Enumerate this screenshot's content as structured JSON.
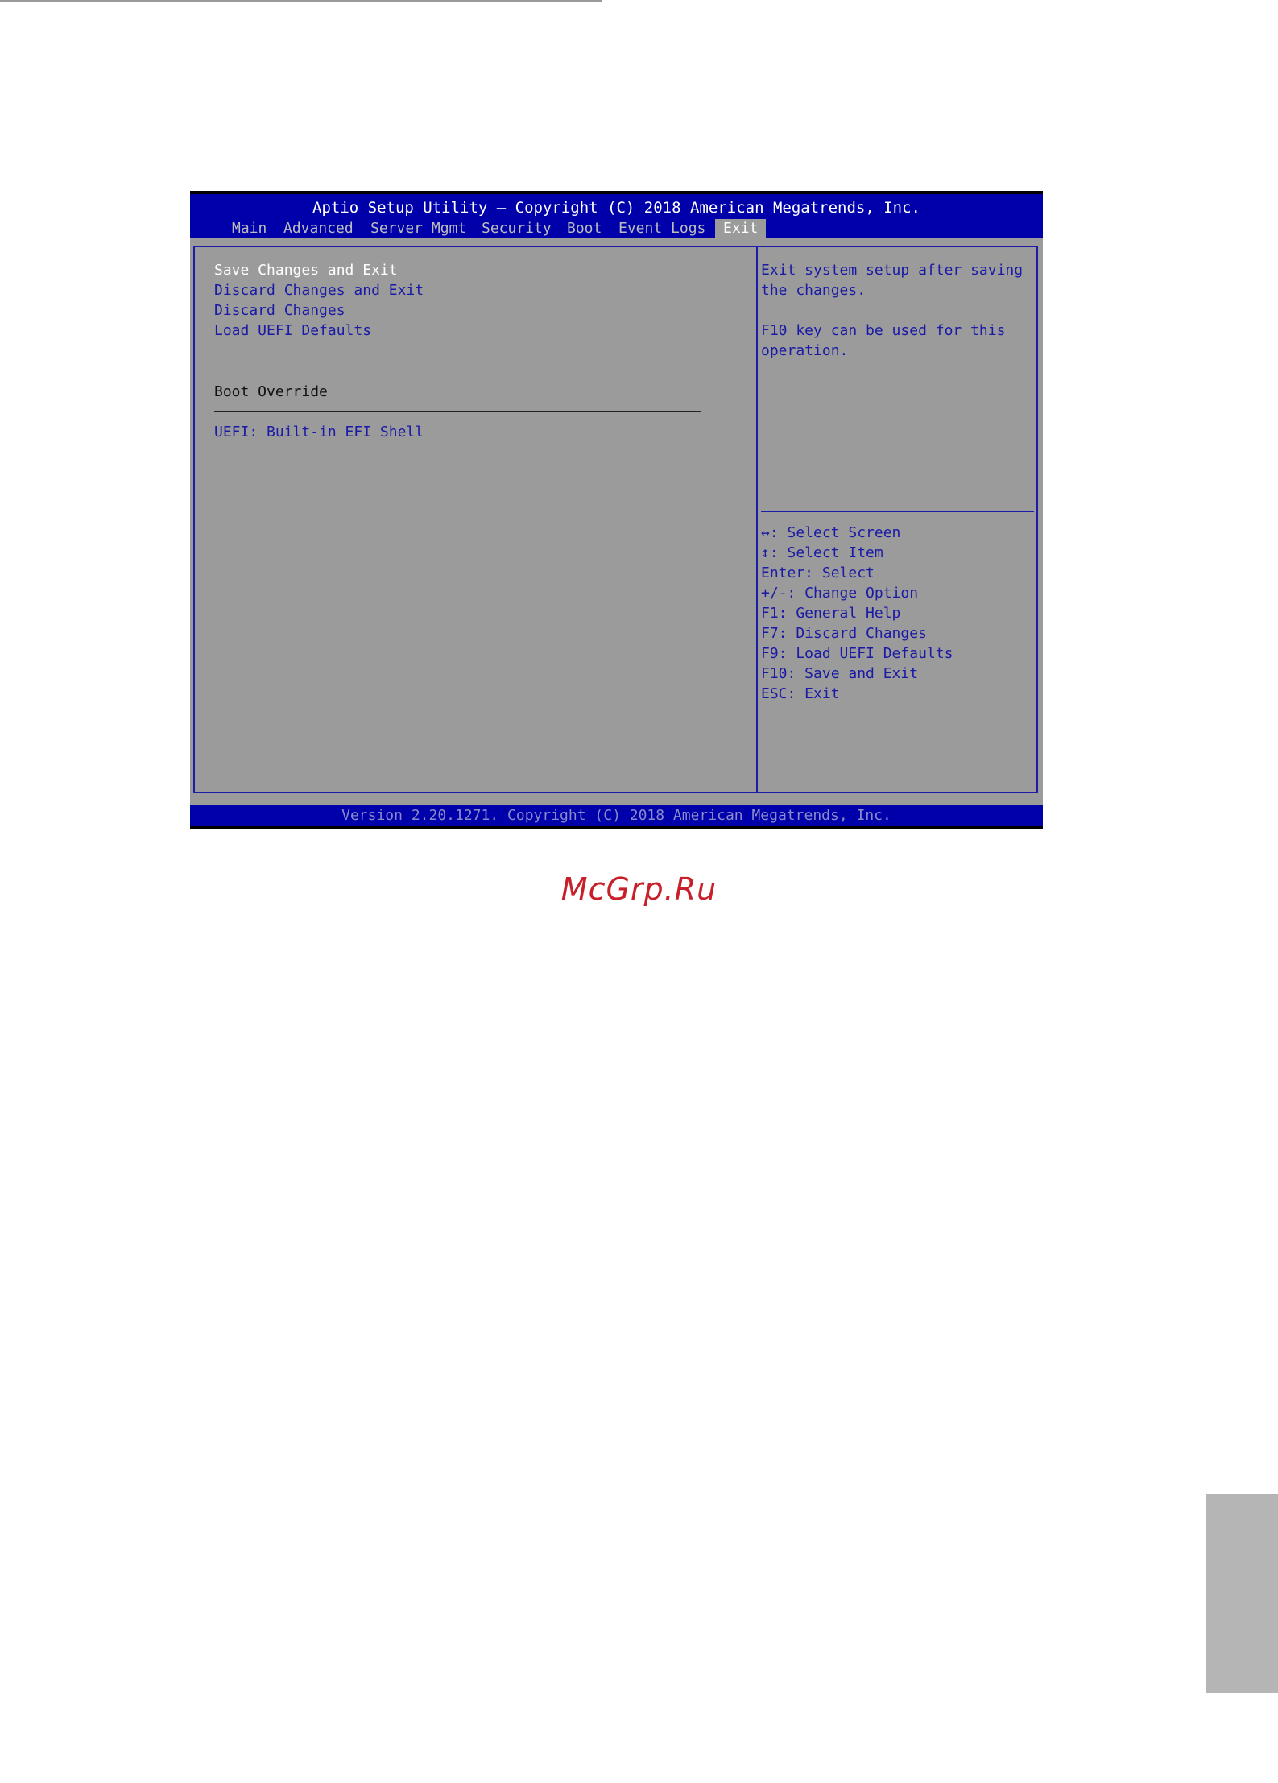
{
  "header": {
    "title": "Aptio Setup Utility – Copyright (C) 2018 American Megatrends, Inc."
  },
  "tabs": [
    {
      "label": "Main"
    },
    {
      "label": "Advanced"
    },
    {
      "label": "Server Mgmt"
    },
    {
      "label": "Security"
    },
    {
      "label": "Boot"
    },
    {
      "label": "Event Logs"
    },
    {
      "label": "Exit"
    }
  ],
  "active_tab": "Exit",
  "menu": {
    "items": [
      {
        "label": "Save Changes and Exit"
      },
      {
        "label": "Discard Changes and Exit"
      },
      {
        "label": "Discard Changes"
      },
      {
        "label": "Load UEFI Defaults"
      }
    ],
    "section_title": "Boot Override",
    "boot_items": [
      {
        "label": "UEFI: Built-in EFI Shell"
      }
    ]
  },
  "help": {
    "lines": [
      "Exit system setup after saving",
      "the changes.",
      "",
      "F10 key can be used for this",
      "operation."
    ],
    "keys": [
      "↔: Select Screen",
      "↕: Select Item",
      "Enter: Select",
      "+/-: Change Option",
      "F1: General Help",
      "F7: Discard Changes",
      "F9: Load UEFI Defaults",
      "F10: Save and Exit",
      "ESC: Exit"
    ]
  },
  "footer": {
    "text": "Version 2.20.1271. Copyright (C) 2018 American Megatrends, Inc."
  },
  "watermark": {
    "text": "McGrp.Ru"
  },
  "colors": {
    "header_blue": "#0000aa",
    "panel_gray": "#9b9b9b",
    "text_blue": "#1a1aa6",
    "selected_white": "#ffffff",
    "watermark_red": "#c8202a"
  }
}
